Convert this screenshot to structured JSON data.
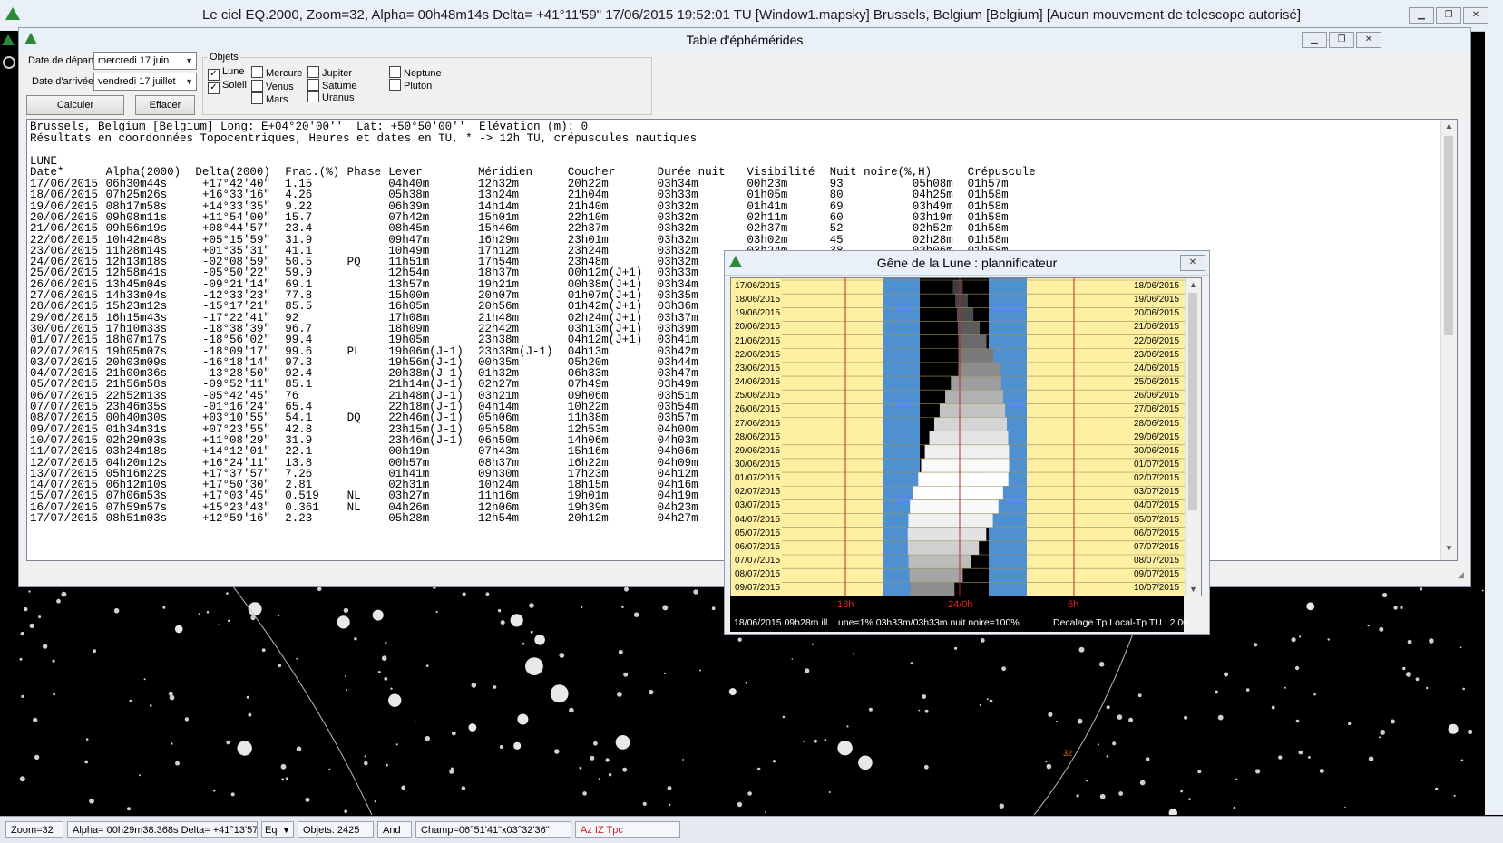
{
  "main": {
    "title": "Le ciel EQ.2000, Zoom=32, Alpha= 00h48m14s Delta= +41°11'59\"    17/06/2015 19:52:01 TU [Window1.mapsky]   Brussels, Belgium [Belgium] [Aucun mouvement de telescope autorisé]",
    "status": {
      "zoom": "Zoom=32",
      "coords": "Alpha= 00h29m38.368s Delta= +41°13'57.94\"",
      "frame": "Eq",
      "objects": "Objets: 2425",
      "constellation": "And",
      "field": "Champ=06°51'41\"x03°32'36\"",
      "modes": "Az IZ Tpc"
    },
    "sky_label": "32"
  },
  "eph": {
    "title": "Table d'éphémérides",
    "start_label": "Date de départ",
    "start_value": "mercredi 17     juin",
    "end_label": "Date d'arrivée",
    "end_value": "vendredi 17     juillet",
    "compute_label": "Calculer",
    "clear_label": "Effacer",
    "objects_label": "Objets",
    "objects": [
      {
        "name": "Lune",
        "checked": true
      },
      {
        "name": "Soleil",
        "checked": true
      },
      {
        "name": "Mercure",
        "checked": false
      },
      {
        "name": "Venus",
        "checked": false
      },
      {
        "name": "Mars",
        "checked": false
      },
      {
        "name": "Jupiter",
        "checked": false
      },
      {
        "name": "Saturne",
        "checked": false
      },
      {
        "name": "Uranus",
        "checked": false
      },
      {
        "name": "Neptune",
        "checked": false
      },
      {
        "name": "Pluton",
        "checked": false
      }
    ],
    "header_line1": "Brussels, Belgium [Belgium] Long: E+04°20'00''  Lat: +50°50'00''  Elévation (m): 0",
    "header_line2": "Résultats en coordonnées Topocentriques, Heures et dates en TU, * -> 12h TU, crépuscules nautiques",
    "section": "LUNE",
    "columns": [
      "Date*",
      "Alpha(2000)",
      "Delta(2000)",
      "Frac.(%)",
      "Phase",
      "Lever",
      "Méridien",
      "Coucher",
      "Durée nuit",
      "Visibilité",
      "Nuit noire(%,H)",
      "",
      "Crépuscule"
    ],
    "rows": [
      [
        "17/06/2015",
        "06h30m44s",
        "+17°42'40\"",
        "1.15",
        "",
        "04h40m",
        "12h32m",
        "20h22m",
        "03h34m",
        "00h23m",
        "93",
        "05h08m",
        "01h57m"
      ],
      [
        "18/06/2015",
        "07h25m26s",
        "+16°33'16\"",
        "4.26",
        "",
        "05h38m",
        "13h24m",
        "21h04m",
        "03h33m",
        "01h05m",
        "80",
        "04h25m",
        "01h58m"
      ],
      [
        "19/06/2015",
        "08h17m58s",
        "+14°33'35\"",
        "9.22",
        "",
        "06h39m",
        "14h14m",
        "21h40m",
        "03h32m",
        "01h41m",
        "69",
        "03h49m",
        "01h58m"
      ],
      [
        "20/06/2015",
        "09h08m11s",
        "+11°54'00\"",
        "15.7",
        "",
        "07h42m",
        "15h01m",
        "22h10m",
        "03h32m",
        "02h11m",
        "60",
        "03h19m",
        "01h58m"
      ],
      [
        "21/06/2015",
        "09h56m19s",
        "+08°44'57\"",
        "23.4",
        "",
        "08h45m",
        "15h46m",
        "22h37m",
        "03h32m",
        "02h37m",
        "52",
        "02h52m",
        "01h58m"
      ],
      [
        "22/06/2015",
        "10h42m48s",
        "+05°15'59\"",
        "31.9",
        "",
        "09h47m",
        "16h29m",
        "23h01m",
        "03h32m",
        "03h02m",
        "45",
        "02h28m",
        "01h58m"
      ],
      [
        "23/06/2015",
        "11h28m14s",
        "+01°35'31\"",
        "41.1",
        "",
        "10h49m",
        "17h12m",
        "23h24m",
        "03h32m",
        "03h24m",
        "38",
        "02h06m",
        "01h58m"
      ],
      [
        "24/06/2015",
        "12h13m18s",
        "-02°08'59\"",
        "50.5",
        "PQ",
        "11h51m",
        "17h54m",
        "23h48m",
        "03h32m",
        "",
        "",
        "",
        ""
      ],
      [
        "25/06/2015",
        "12h58m41s",
        "-05°50'22\"",
        "59.9",
        "",
        "12h54m",
        "18h37m",
        "00h12m(J+1)",
        "03h33m",
        "",
        "",
        "",
        ""
      ],
      [
        "26/06/2015",
        "13h45m04s",
        "-09°21'14\"",
        "69.1",
        "",
        "13h57m",
        "19h21m",
        "00h38m(J+1)",
        "03h34m",
        "",
        "",
        "",
        ""
      ],
      [
        "27/06/2015",
        "14h33m04s",
        "-12°33'23\"",
        "77.8",
        "",
        "15h00m",
        "20h07m",
        "01h07m(J+1)",
        "03h35m",
        "",
        "",
        "",
        ""
      ],
      [
        "28/06/2015",
        "15h23m12s",
        "-15°17'21\"",
        "85.5",
        "",
        "16h05m",
        "20h56m",
        "01h42m(J+1)",
        "03h36m",
        "",
        "",
        "",
        ""
      ],
      [
        "29/06/2015",
        "16h15m43s",
        "-17°22'41\"",
        "92",
        "",
        "17h08m",
        "21h48m",
        "02h24m(J+1)",
        "03h37m",
        "",
        "",
        "",
        ""
      ],
      [
        "30/06/2015",
        "17h10m33s",
        "-18°38'39\"",
        "96.7",
        "",
        "18h09m",
        "22h42m",
        "03h13m(J+1)",
        "03h39m",
        "",
        "",
        "",
        ""
      ],
      [
        "01/07/2015",
        "18h07m17s",
        "-18°56'02\"",
        "99.4",
        "",
        "19h05m",
        "23h38m",
        "04h12m(J+1)",
        "03h41m",
        "",
        "",
        "",
        ""
      ],
      [
        "02/07/2015",
        "19h05m07s",
        "-18°09'17\"",
        "99.6",
        "PL",
        "19h06m(J-1)",
        "23h38m(J-1)",
        "04h13m",
        "03h42m",
        "",
        "",
        "",
        ""
      ],
      [
        "03/07/2015",
        "20h03m09s",
        "-16°18'14\"",
        "97.3",
        "",
        "19h56m(J-1)",
        "00h35m",
        "05h20m",
        "03h44m",
        "",
        "",
        "",
        ""
      ],
      [
        "04/07/2015",
        "21h00m36s",
        "-13°28'50\"",
        "92.4",
        "",
        "20h38m(J-1)",
        "01h32m",
        "06h33m",
        "03h47m",
        "",
        "",
        "",
        ""
      ],
      [
        "05/07/2015",
        "21h56m58s",
        "-09°52'11\"",
        "85.1",
        "",
        "21h14m(J-1)",
        "02h27m",
        "07h49m",
        "03h49m",
        "",
        "",
        "",
        ""
      ],
      [
        "06/07/2015",
        "22h52m13s",
        "-05°42'45\"",
        "76",
        "",
        "21h48m(J-1)",
        "03h21m",
        "09h06m",
        "03h51m",
        "",
        "",
        "",
        ""
      ],
      [
        "07/07/2015",
        "23h46m35s",
        "-01°16'24\"",
        "65.4",
        "",
        "22h18m(J-1)",
        "04h14m",
        "10h22m",
        "03h54m",
        "",
        "",
        "",
        ""
      ],
      [
        "08/07/2015",
        "00h40m30s",
        "+03°10'55\"",
        "54.1",
        "DQ",
        "22h46m(J-1)",
        "05h06m",
        "11h38m",
        "03h57m",
        "",
        "",
        "",
        ""
      ],
      [
        "09/07/2015",
        "01h34m31s",
        "+07°23'55\"",
        "42.8",
        "",
        "23h15m(J-1)",
        "05h58m",
        "12h53m",
        "04h00m",
        "",
        "",
        "",
        ""
      ],
      [
        "10/07/2015",
        "02h29m03s",
        "+11°08'29\"",
        "31.9",
        "",
        "23h46m(J-1)",
        "06h50m",
        "14h06m",
        "04h03m",
        "",
        "",
        "",
        ""
      ],
      [
        "11/07/2015",
        "03h24m18s",
        "+14°12'01\"",
        "22.1",
        "",
        "00h19m",
        "07h43m",
        "15h16m",
        "04h06m",
        "",
        "",
        "",
        ""
      ],
      [
        "12/07/2015",
        "04h20m12s",
        "+16°24'11\"",
        "13.8",
        "",
        "00h57m",
        "08h37m",
        "16h22m",
        "04h09m",
        "",
        "",
        "",
        ""
      ],
      [
        "13/07/2015",
        "05h16m22s",
        "+17°37'57\"",
        "7.26",
        "",
        "01h41m",
        "09h30m",
        "17h23m",
        "04h12m",
        "",
        "",
        "",
        ""
      ],
      [
        "14/07/2015",
        "06h12m10s",
        "+17°50'30\"",
        "2.81",
        "",
        "02h31m",
        "10h24m",
        "18h15m",
        "04h16m",
        "",
        "",
        "",
        ""
      ],
      [
        "15/07/2015",
        "07h06m53s",
        "+17°03'45\"",
        "0.519",
        "NL",
        "03h27m",
        "11h16m",
        "19h01m",
        "04h19m",
        "",
        "",
        "",
        ""
      ],
      [
        "16/07/2015",
        "07h59m57s",
        "+15°23'43\"",
        "0.361",
        "NL",
        "04h26m",
        "12h06m",
        "19h39m",
        "04h23m",
        "",
        "",
        "",
        ""
      ],
      [
        "17/07/2015",
        "08h51m03s",
        "+12°59'16\"",
        "2.23",
        "",
        "05h28m",
        "12h54m",
        "20h12m",
        "04h27m",
        "",
        "",
        "",
        ""
      ]
    ]
  },
  "planner": {
    "title": "Gêne de la Lune : plannificateur",
    "left_dates": [
      "17/06/2015",
      "18/06/2015",
      "19/06/2015",
      "20/06/2015",
      "21/06/2015",
      "22/06/2015",
      "23/06/2015",
      "24/06/2015",
      "25/06/2015",
      "26/06/2015",
      "27/06/2015",
      "28/06/2015",
      "29/06/2015",
      "30/06/2015",
      "01/07/2015",
      "02/07/2015",
      "03/07/2015",
      "04/07/2015",
      "05/07/2015",
      "06/07/2015",
      "07/07/2015",
      "08/07/2015",
      "09/07/2015"
    ],
    "right_dates": [
      "18/06/2015",
      "19/06/2015",
      "20/06/2015",
      "21/06/2015",
      "22/06/2015",
      "23/06/2015",
      "24/06/2015",
      "25/06/2015",
      "26/06/2015",
      "27/06/2015",
      "28/06/2015",
      "29/06/2015",
      "30/06/2015",
      "01/07/2015",
      "02/07/2015",
      "03/07/2015",
      "04/07/2015",
      "05/07/2015",
      "06/07/2015",
      "07/07/2015",
      "08/07/2015",
      "09/07/2015",
      "10/07/2015"
    ],
    "hour_labels": [
      "18h",
      "24/0h",
      "6h"
    ],
    "info": "18/06/2015 09h28m  ill. Lune=1%  03h33m/03h33m  nuit noire=100%",
    "offset": "Decalage Tp Local-Tp TU : 2.00",
    "moon_fraction": [
      0.012,
      0.043,
      0.092,
      0.157,
      0.234,
      0.319,
      0.411,
      0.505,
      0.599,
      0.691,
      0.778,
      0.855,
      0.92,
      0.967,
      0.994,
      0.996,
      0.973,
      0.924,
      0.851,
      0.76,
      0.654,
      0.541,
      0.428
    ],
    "colors": {
      "day": "#fdf0a0",
      "twilight": "#4f90d0",
      "night": "#000000",
      "hourline": "#d02020"
    }
  }
}
